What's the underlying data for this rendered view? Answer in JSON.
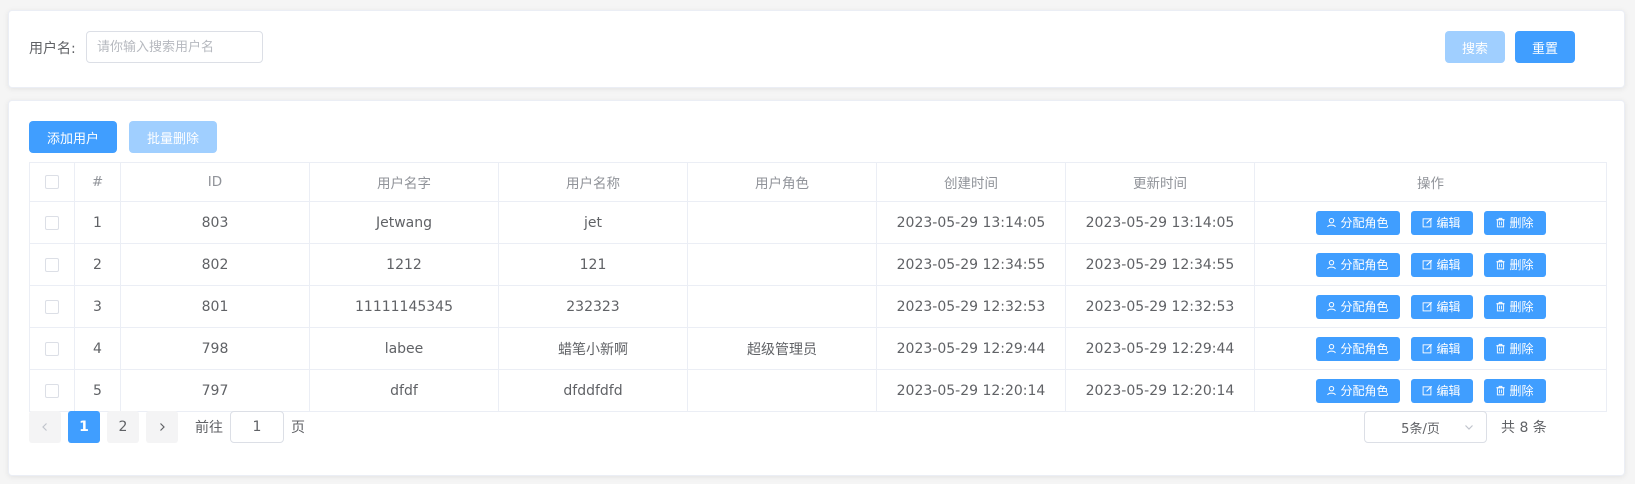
{
  "search": {
    "label": "用户名:",
    "placeholder": "请你输入搜索用户名",
    "value": "",
    "search_label": "搜索",
    "reset_label": "重置"
  },
  "toolbar": {
    "add_label": "添加用户",
    "batch_delete_label": "批量删除"
  },
  "table": {
    "headers": [
      "#",
      "ID",
      "用户名字",
      "用户名称",
      "用户角色",
      "创建时间",
      "更新时间",
      "操作"
    ],
    "rows": [
      {
        "index": "1",
        "id": "803",
        "username": "Jetwang",
        "name": "jet",
        "role": "",
        "created": "2023-05-29 13:14:05",
        "updated": "2023-05-29 13:14:05"
      },
      {
        "index": "2",
        "id": "802",
        "username": "1212",
        "name": "121",
        "role": "",
        "created": "2023-05-29 12:34:55",
        "updated": "2023-05-29 12:34:55"
      },
      {
        "index": "3",
        "id": "801",
        "username": "11111145345",
        "name": "232323",
        "role": "",
        "created": "2023-05-29 12:32:53",
        "updated": "2023-05-29 12:32:53"
      },
      {
        "index": "4",
        "id": "798",
        "username": "labee",
        "name": "蜡笔小新啊",
        "role": "超级管理员",
        "created": "2023-05-29 12:29:44",
        "updated": "2023-05-29 12:29:44"
      },
      {
        "index": "5",
        "id": "797",
        "username": "dfdf",
        "name": "dfddfdfd",
        "role": "",
        "created": "2023-05-29 12:20:14",
        "updated": "2023-05-29 12:20:14"
      }
    ],
    "actions": {
      "assign_role": "分配角色",
      "edit": "编辑",
      "delete": "删除"
    }
  },
  "pagination": {
    "pages": [
      "1",
      "2"
    ],
    "current": "1",
    "goto_label": "前往",
    "goto_value": "1",
    "page_suffix": "页",
    "page_size": "5条/页",
    "total": "共 8 条"
  },
  "colors": {
    "primary": "#409eff",
    "primary_disabled": "#a0cfff"
  }
}
